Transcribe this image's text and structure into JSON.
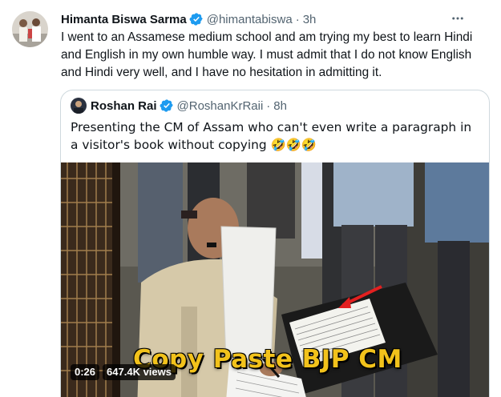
{
  "tweet": {
    "author_name": "Himanta Biswa Sarma",
    "handle": "@himantabiswa",
    "separator": "·",
    "time": "3h",
    "text": "I went to an Assamese medium school and am trying my best to learn Hindi and English in my own humble way. I must admit that I do not know English and Hindi very well, and I have no hesitation in admitting it.",
    "more_icon": "more-icon",
    "verified_color": "#1d9bf0"
  },
  "quote": {
    "author_name": "Roshan Rai",
    "handle": "@RoshanKrRaii",
    "separator": "·",
    "time": "8h",
    "text": "Presenting the CM of Assam who can't even write a paragraph in a visitor's book without copying 🤣🤣🤣",
    "video": {
      "caption": "Copy Paste BJP CM",
      "duration": "0:26",
      "views": "647.4K views"
    }
  },
  "colors": {
    "text": "#0f1419",
    "secondary": "#536471",
    "border": "#cfd9de",
    "caption": "#f2c21b"
  }
}
